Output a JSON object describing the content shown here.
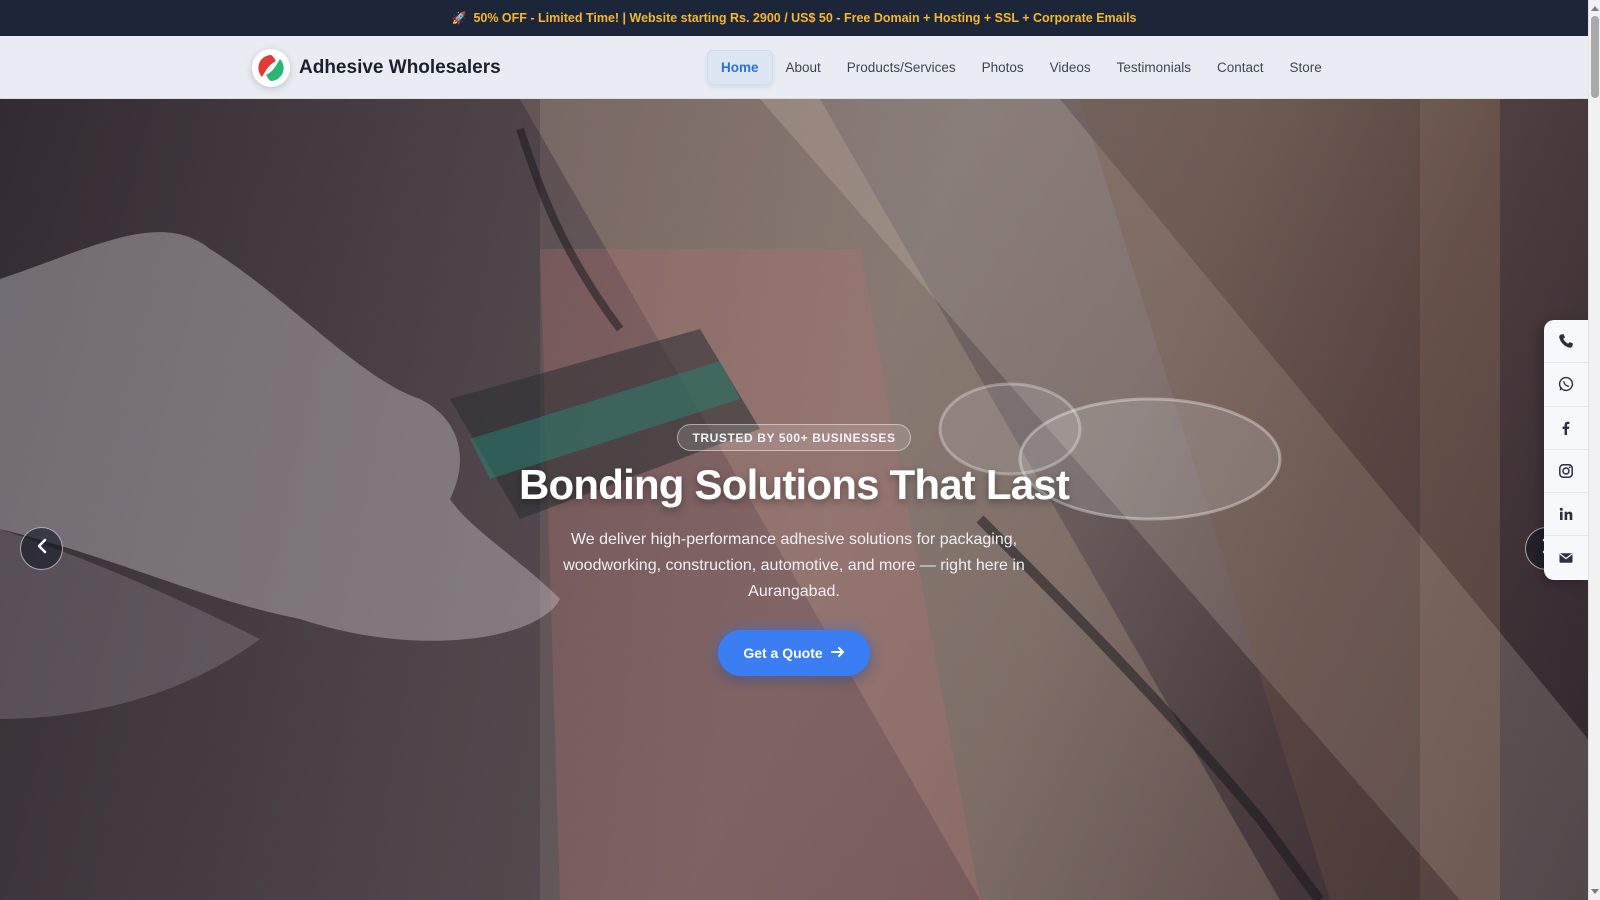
{
  "promo": {
    "icon": "rocket-icon",
    "text": "50% OFF - Limited Time! | Website starting Rs. 2900 / US$ 50 - Free Domain + Hosting + SSL + Corporate Emails",
    "color": "#f5b731"
  },
  "brand": {
    "name": "Adhesive Wholesalers",
    "logo_colors": [
      "#e23b35",
      "#2bb673"
    ]
  },
  "nav": {
    "items": [
      {
        "label": "Home",
        "active": true
      },
      {
        "label": "About"
      },
      {
        "label": "Products/Services"
      },
      {
        "label": "Photos"
      },
      {
        "label": "Videos"
      },
      {
        "label": "Testimonials"
      },
      {
        "label": "Contact"
      },
      {
        "label": "Store"
      }
    ],
    "active_color": "#2f6fdb"
  },
  "hero": {
    "badge": "TRUSTED BY 500+ BUSINESSES",
    "title": "Bonding Solutions That Last",
    "text": "We deliver high-performance adhesive solutions for packaging, woodworking, construction, automotive, and more — right here in Aurangabad.",
    "cta_label": "Get a Quote",
    "cta_icon": "arrow-right-icon",
    "cta_color": "#3b7df2"
  },
  "carousel": {
    "prev_icon": "chevron-left-icon",
    "next_icon": "chevron-right-icon"
  },
  "social": {
    "icons": [
      "phone-icon",
      "whatsapp-icon",
      "facebook-icon",
      "instagram-icon",
      "linkedin-icon",
      "email-icon"
    ]
  }
}
